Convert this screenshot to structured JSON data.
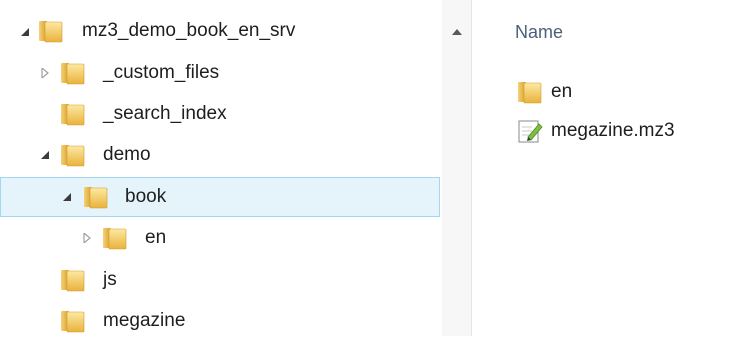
{
  "tree": {
    "items": [
      {
        "label": "mz3_demo_book_en_srv",
        "expanded": true
      },
      {
        "label": "_custom_files",
        "expanded": false
      },
      {
        "label": "_search_index"
      },
      {
        "label": "demo",
        "expanded": true
      },
      {
        "label": "book",
        "expanded": true,
        "selected": true
      },
      {
        "label": "en",
        "expanded": false
      },
      {
        "label": "js"
      },
      {
        "label": "megazine"
      }
    ]
  },
  "content": {
    "column_header": "Name",
    "files": [
      {
        "name": "en",
        "icon": "folder-icon"
      },
      {
        "name": "megazine.mz3",
        "icon": "file-edit-icon"
      }
    ]
  },
  "colors": {
    "selection_bg": "#e5f3fb",
    "selection_border": "#a5d6f1",
    "header_text": "#4c607a",
    "folder_yellow": "#f5c84b"
  }
}
